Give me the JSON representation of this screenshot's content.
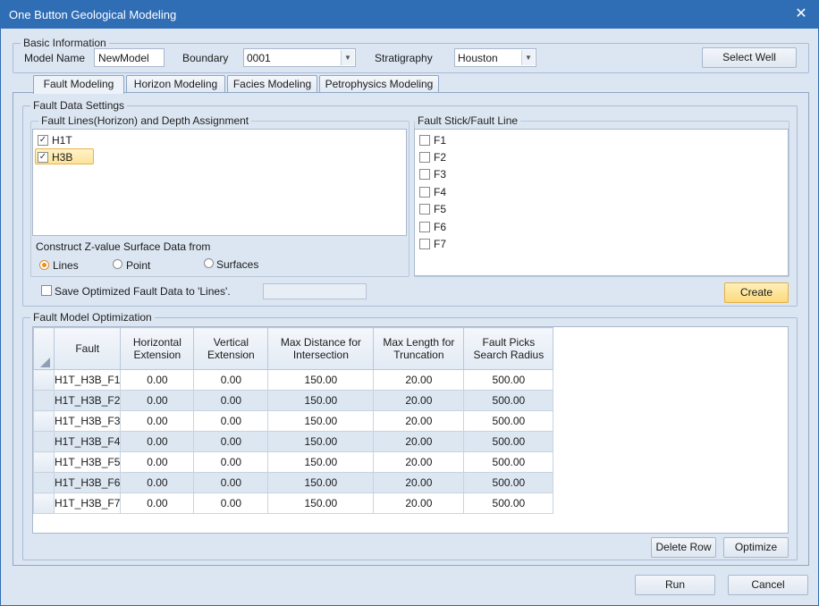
{
  "window": {
    "title": "One Button Geological Modeling",
    "close_glyph": "✕"
  },
  "basic_info": {
    "group_title": "Basic Information",
    "model_name_label": "Model Name",
    "model_name_value": "NewModel",
    "boundary_label": "Boundary",
    "boundary_value": "0001",
    "stratigraphy_label": "Stratigraphy",
    "stratigraphy_value": "Houston",
    "select_well_label": "Select Well"
  },
  "tabs": [
    {
      "label": "Fault Modeling",
      "active": true
    },
    {
      "label": "Horizon Modeling",
      "active": false
    },
    {
      "label": "Facies Modeling",
      "active": false
    },
    {
      "label": "Petrophysics Modeling",
      "active": false
    }
  ],
  "fault_settings": {
    "group_title": "Fault Data Settings",
    "lines_group_title": "Fault Lines(Horizon) and Depth Assignment",
    "lines": [
      {
        "label": "H1T",
        "checked": true,
        "selected": false
      },
      {
        "label": "H3B",
        "checked": true,
        "selected": true
      }
    ],
    "construct_label": "Construct Z-value Surface Data from",
    "construct_options": [
      {
        "label": "Lines",
        "selected": true
      },
      {
        "label": "Point",
        "selected": false
      },
      {
        "label": "Surfaces",
        "selected": false
      }
    ],
    "stick_group_title": "Fault Stick/Fault Line",
    "sticks": [
      {
        "label": "F1",
        "checked": false
      },
      {
        "label": "F2",
        "checked": false
      },
      {
        "label": "F3",
        "checked": false
      },
      {
        "label": "F4",
        "checked": false
      },
      {
        "label": "F5",
        "checked": false
      },
      {
        "label": "F6",
        "checked": false
      },
      {
        "label": "F7",
        "checked": false
      }
    ],
    "save_optimized_label": "Save Optimized Fault Data to 'Lines'.",
    "save_optimized_checked": false,
    "create_label": "Create"
  },
  "optimization": {
    "group_title": "Fault Model Optimization",
    "columns": [
      "Fault",
      "Horizontal Extension",
      "Vertical Extension",
      "Max Distance for Intersection",
      "Max Length for Truncation",
      "Fault Picks Search Radius"
    ],
    "rows": [
      [
        "H1T_H3B_F1",
        "0.00",
        "0.00",
        "150.00",
        "20.00",
        "500.00"
      ],
      [
        "H1T_H3B_F2",
        "0.00",
        "0.00",
        "150.00",
        "20.00",
        "500.00"
      ],
      [
        "H1T_H3B_F3",
        "0.00",
        "0.00",
        "150.00",
        "20.00",
        "500.00"
      ],
      [
        "H1T_H3B_F4",
        "0.00",
        "0.00",
        "150.00",
        "20.00",
        "500.00"
      ],
      [
        "H1T_H3B_F5",
        "0.00",
        "0.00",
        "150.00",
        "20.00",
        "500.00"
      ],
      [
        "H1T_H3B_F6",
        "0.00",
        "0.00",
        "150.00",
        "20.00",
        "500.00"
      ],
      [
        "H1T_H3B_F7",
        "0.00",
        "0.00",
        "150.00",
        "20.00",
        "500.00"
      ]
    ],
    "delete_row_label": "Delete Row",
    "optimize_label": "Optimize"
  },
  "footer": {
    "run_label": "Run",
    "cancel_label": "Cancel"
  },
  "colors": {
    "titlebar": "#2f6db5",
    "window_bg": "#dce6f2",
    "selection": "#fde39a",
    "radio_dot": "#ee8f1a"
  }
}
